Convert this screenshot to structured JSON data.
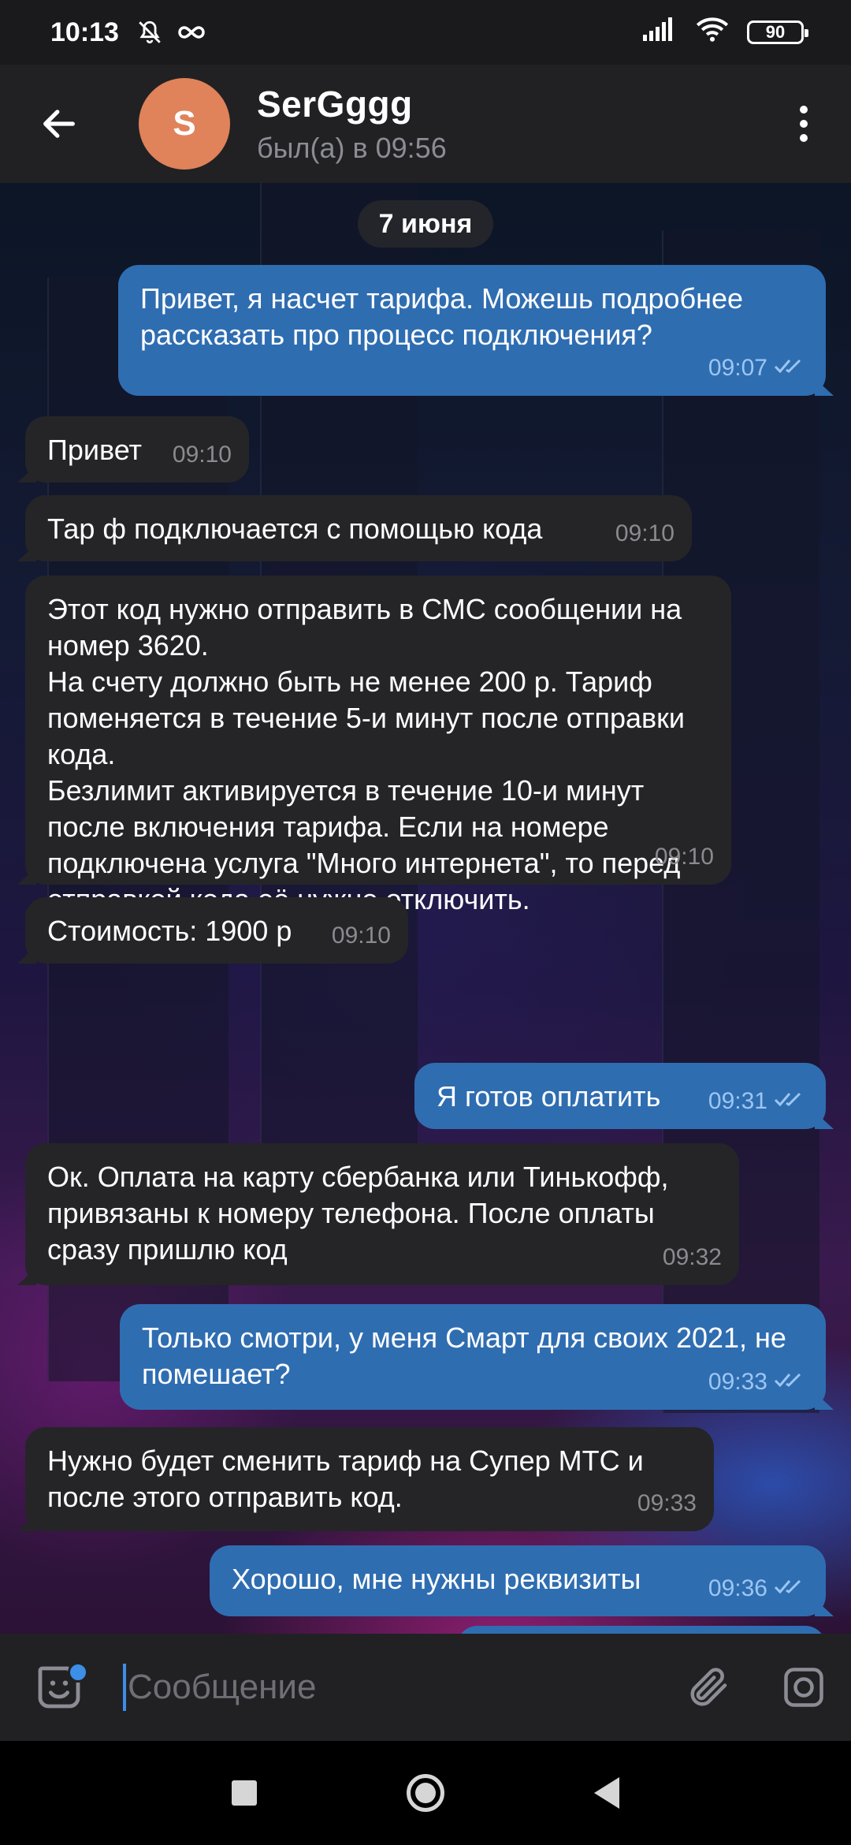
{
  "status": {
    "time": "10:13",
    "battery": "90",
    "icons": [
      "bell-off-icon",
      "infinity-icon",
      "signal-icon",
      "wifi-icon",
      "battery-icon"
    ]
  },
  "header": {
    "avatar_letter": "S",
    "avatar_color": "#e0825a",
    "title": "SerGggg",
    "subtitle": "был(а) в 09:56"
  },
  "chat": {
    "date_label": "7 июня",
    "messages": [
      {
        "dir": "out",
        "text": "Привет, я насчет тарифа. Можешь подробнее рассказать про процесс подключения?",
        "time": "09:07"
      },
      {
        "dir": "in",
        "text": "Привет",
        "time": "09:10"
      },
      {
        "dir": "in",
        "text": "Тар ф подключается с помощью кода",
        "time": "09:10"
      },
      {
        "dir": "in",
        "text": "Этот код нужно отправить в СМС сообщении на номер 3620.\nНа счету должно быть не менее 200 р. Тариф поменяется в течение 5-и минут после отправки кода.\nБезлимит активируется в течение 10-и минут после включения тарифа. Если на номере подключена услуга \"Много интернета\", то перед отправкой кода её нужно отключить.",
        "time": "09:10"
      },
      {
        "dir": "in",
        "text": "Стоимость: 1900 р",
        "time": "09:10"
      },
      {
        "dir": "out",
        "text": "Я готов оплатить",
        "time": "09:31"
      },
      {
        "dir": "in",
        "text": "Ок. Оплата на карту сбербанка или Тинькофф, привязаны к номеру телефона. После оплаты сразу пришлю код",
        "time": "09:32"
      },
      {
        "dir": "out",
        "text": "Только смотри, у меня Смарт для своих 2021, не помешает?",
        "time": "09:33"
      },
      {
        "dir": "in",
        "text": "Нужно будет сменить тариф на Супер МТС и после этого отправить код.",
        "time": "09:33"
      },
      {
        "dir": "out",
        "text": "Хорошо, мне нужны реквизиты",
        "time": "09:36"
      }
    ]
  },
  "input": {
    "placeholder": "Сообщение"
  },
  "colors": {
    "outgoing_bubble": "#2f6db1",
    "incoming_bubble": "#252528",
    "accent": "#3c8ee6"
  }
}
